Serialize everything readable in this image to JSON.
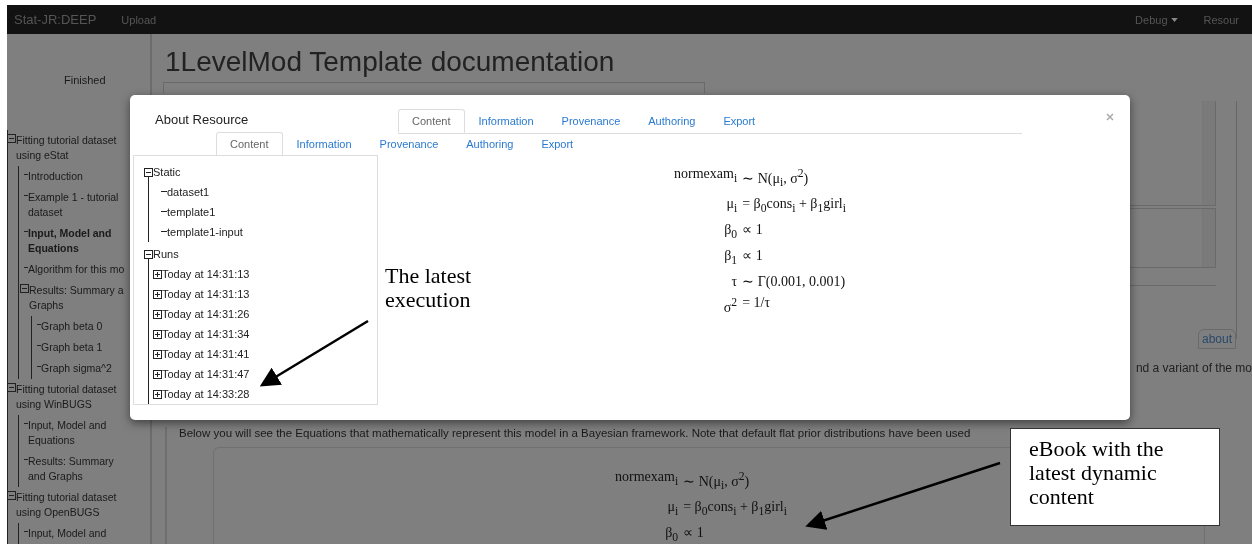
{
  "navbar": {
    "brand": "Stat-JR:DEEP",
    "links": [
      "Upload"
    ],
    "right": [
      {
        "label": "Debug",
        "dropdown": true
      },
      {
        "label": "Resour",
        "dropdown": false
      }
    ]
  },
  "sidebar": {
    "status": "Finished",
    "tree": [
      {
        "label": "Fitting tutorial dataset using eStat",
        "expanded": true,
        "selected": false,
        "children": [
          {
            "label": "Introduction",
            "selected": false
          },
          {
            "label": "Example 1 - tutorial dataset",
            "selected": false
          },
          {
            "label": "Input, Model and Equations",
            "selected": true
          },
          {
            "label": "Algorithm for this mo",
            "selected": false
          },
          {
            "label": "Results: Summary a\nGraphs",
            "expanded": true,
            "selected": false,
            "children": [
              {
                "label": "Graph beta 0",
                "selected": false
              },
              {
                "label": "Graph beta 1",
                "selected": false
              },
              {
                "label": "Graph sigma^2",
                "selected": false
              }
            ]
          }
        ]
      },
      {
        "label": "Fitting tutorial dataset using WinBUGS",
        "expanded": true,
        "selected": false,
        "children": [
          {
            "label": "Input, Model and Equations",
            "selected": false
          },
          {
            "label": "Results: Summary and Graphs",
            "selected": false
          }
        ]
      },
      {
        "label": "Fitting tutorial dataset using OpenBUGS",
        "expanded": true,
        "selected": false,
        "children": [
          {
            "label": "Input, Model and",
            "selected": false
          }
        ]
      }
    ]
  },
  "main": {
    "title": "1LevelMod Template documentation",
    "about_tab": "about",
    "side_note": "nd a variant of the mo",
    "intro": "Below you will see the Equations that mathematically represent this model in a Bayesian framework. Note that default flat prior distributions have been used",
    "equations": [
      {
        "lhs": "normexam$_{i}$",
        "rhs": "∼ N(μ$_{i}$, σ$^{2}$)"
      },
      {
        "lhs": "μ$_{i}$",
        "rhs": "= β$_{0}$cons$_{i}$ + β$_{1}$girl$_{i}$"
      },
      {
        "lhs": "β$_{0}$",
        "rhs": "∝ 1"
      }
    ]
  },
  "modal": {
    "title": "About Resource",
    "back_tabs": [
      {
        "label": "Content",
        "selected": true
      },
      {
        "label": "Information",
        "selected": false
      },
      {
        "label": "Provenance",
        "selected": false
      },
      {
        "label": "Authoring",
        "selected": false
      },
      {
        "label": "Export",
        "selected": false
      }
    ],
    "tabs": [
      {
        "label": "Content",
        "selected": true
      },
      {
        "label": "Information",
        "selected": false
      },
      {
        "label": "Provenance",
        "selected": false
      },
      {
        "label": "Authoring",
        "selected": false
      },
      {
        "label": "Export",
        "selected": false
      }
    ],
    "tree": [
      {
        "label": "Static",
        "expanded": true,
        "children": [
          {
            "label": "dataset1"
          },
          {
            "label": "template1"
          },
          {
            "label": "template1-input"
          }
        ]
      },
      {
        "label": "Runs",
        "expanded": true,
        "children": [
          {
            "label": "Today at 14:31:13",
            "expanded": false
          },
          {
            "label": "Today at 14:31:13",
            "expanded": false
          },
          {
            "label": "Today at 14:31:26",
            "expanded": false
          },
          {
            "label": "Today at 14:31:34",
            "expanded": false
          },
          {
            "label": "Today at 14:31:41",
            "expanded": false
          },
          {
            "label": "Today at 14:31:47",
            "expanded": false
          },
          {
            "label": "Today at 14:33:28",
            "expanded": false
          }
        ]
      }
    ],
    "equations": [
      {
        "lhs": "normexam$_{i}$",
        "rhs": "∼ N(μ$_{i}$, σ$^{2}$)"
      },
      {
        "lhs": "μ$_{i}$",
        "rhs": "= β$_{0}$cons$_{i}$ + β$_{1}$girl$_{i}$"
      },
      {
        "lhs": "β$_{0}$",
        "rhs": "∝ 1"
      },
      {
        "lhs": "β$_{1}$",
        "rhs": "∝ 1"
      },
      {
        "lhs": "τ",
        "rhs": "∼ Γ(0.001, 0.001)"
      },
      {
        "lhs": "σ$^{2}$",
        "rhs": "= 1/τ"
      }
    ]
  },
  "annotations": [
    {
      "kind": "plain",
      "text": "The latest execution"
    },
    {
      "kind": "boxed",
      "text": "eBook with the latest dynamic content"
    }
  ]
}
